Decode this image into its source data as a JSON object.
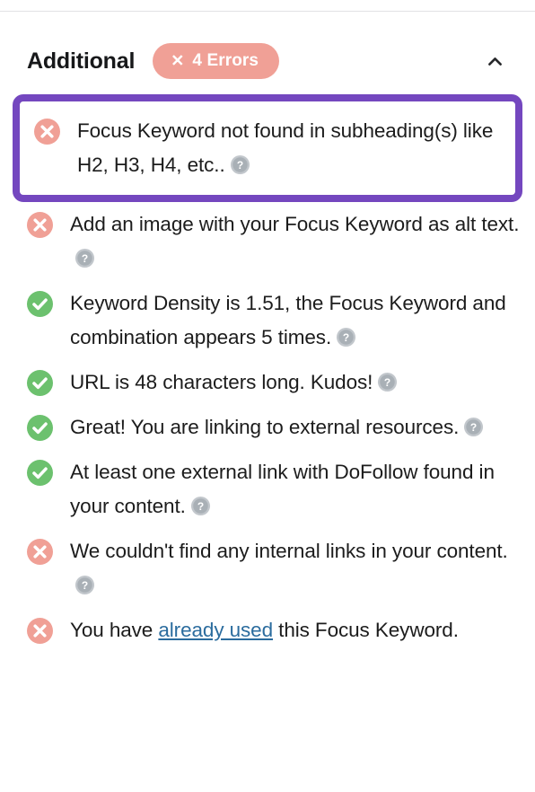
{
  "header": {
    "title": "Additional",
    "badge": {
      "icon": "close-x-icon",
      "count": 4,
      "label": "4 Errors"
    },
    "collapse_icon": "chevron-up-icon",
    "collapsed": false
  },
  "colors": {
    "error": "#f0a096",
    "success": "#6cc16e",
    "highlight_border": "#7447bf",
    "help_icon": "#b3b8bd",
    "link": "#2b6c9e",
    "text": "#1c1c1c",
    "background": "#ffffff",
    "divider": "#e2e2e4"
  },
  "checks": [
    {
      "status": "error",
      "icon": "error-x-icon",
      "text": "Focus Keyword not found in subheading(s) like H2, H3, H4, etc..",
      "has_help": true,
      "help_icon": "question-mark-icon",
      "highlighted": true
    },
    {
      "status": "error",
      "icon": "error-x-icon",
      "text": "Add an image with your Focus Keyword as alt text.",
      "has_help": true,
      "help_icon": "question-mark-icon",
      "highlighted": false
    },
    {
      "status": "success",
      "icon": "success-check-icon",
      "text": "Keyword Density is 1.51, the Focus Keyword and combination appears 5 times.",
      "has_help": true,
      "help_icon": "question-mark-icon",
      "highlighted": false
    },
    {
      "status": "success",
      "icon": "success-check-icon",
      "text": "URL is 48 characters long. Kudos!",
      "has_help": true,
      "help_icon": "question-mark-icon",
      "highlighted": false
    },
    {
      "status": "success",
      "icon": "success-check-icon",
      "text": "Great! You are linking to external resources.",
      "has_help": true,
      "help_icon": "question-mark-icon",
      "highlighted": false
    },
    {
      "status": "success",
      "icon": "success-check-icon",
      "text": "At least one external link with DoFollow found in your content.",
      "has_help": true,
      "help_icon": "question-mark-icon",
      "highlighted": false
    },
    {
      "status": "error",
      "icon": "error-x-icon",
      "text": "We couldn't find any internal links in your content.",
      "has_help": true,
      "help_icon": "question-mark-icon",
      "highlighted": false
    },
    {
      "status": "error",
      "icon": "error-x-icon",
      "text_before_link": "You have ",
      "link_text": "already used",
      "text_after_link": " this Focus Keyword.",
      "has_help": false,
      "highlighted": false
    }
  ]
}
